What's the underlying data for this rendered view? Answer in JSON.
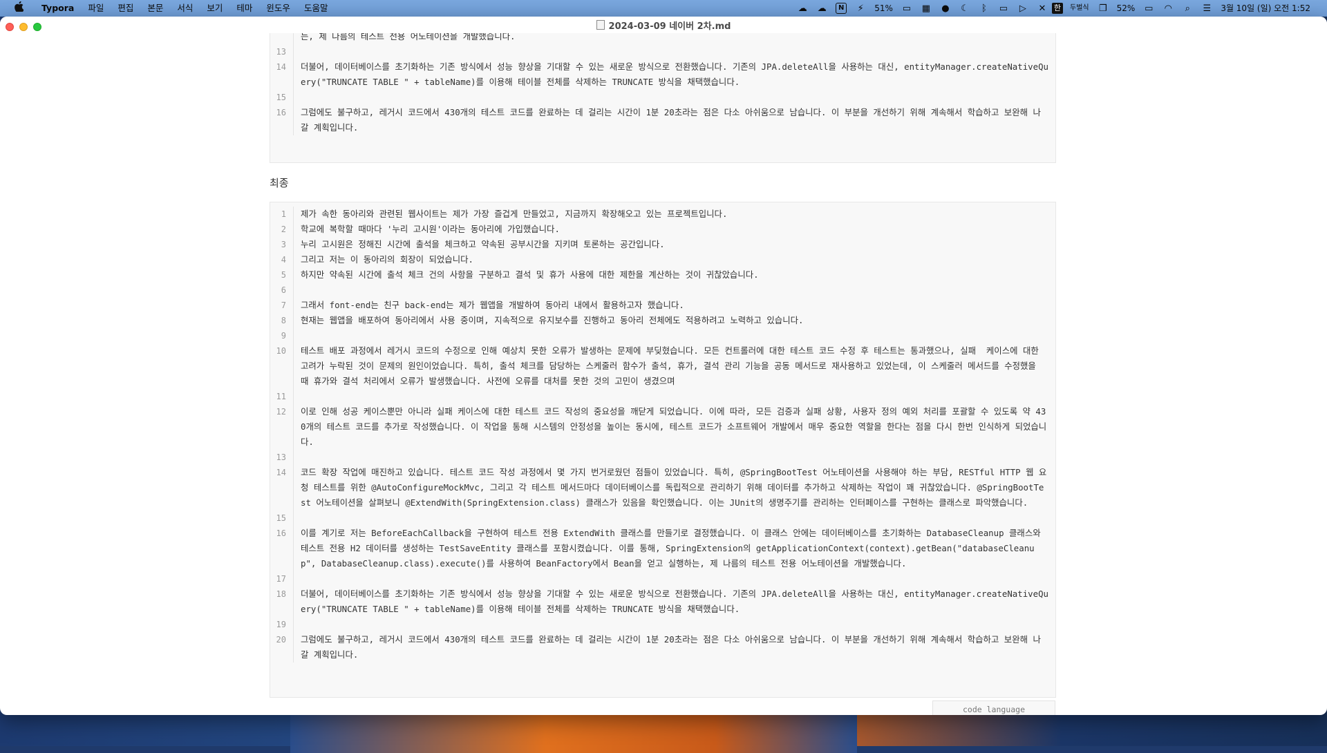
{
  "menubar": {
    "apple": "",
    "app_name": "Typora",
    "menus": [
      "파일",
      "편집",
      "본문",
      "서식",
      "보기",
      "테마",
      "윈도우",
      "도움말"
    ],
    "battery1": "51%",
    "ime_badge": "한",
    "ime_label": "두벌식",
    "battery2": "52%",
    "datetime": "3월 10일 (일) 오전 1:52"
  },
  "window": {
    "title": "2024-03-09 네이버 2차.md"
  },
  "top_block": {
    "lines": [
      {
        "n": "",
        "text": "는, 제 나름의 테스트 전용 어노테이션을 개발했습니다."
      },
      {
        "n": "13",
        "text": ""
      },
      {
        "n": "14",
        "text": "더불어, 데이터베이스를 초기화하는 기존 방식에서 성능 향상을 기대할 수 있는 새로운 방식으로 전환했습니다. 기존의 JPA.deleteAll을 사용하는 대신, entityManager.createNativeQuery(\"TRUNCATE TABLE \" + tableName)를 이용해 테이블 전체를 삭제하는 TRUNCATE 방식을 채택했습니다."
      },
      {
        "n": "15",
        "text": ""
      },
      {
        "n": "16",
        "text": "그럼에도 불구하고, 레거시 코드에서 430개의 테스트 코드를 완료하는 데 걸리는 시간이 1분 20초라는 점은 다소 아쉬움으로 남습니다. 이 부분을 개선하기 위해 계속해서 학습하고 보완해 나갈 계획입니다."
      }
    ]
  },
  "heading": "최종",
  "bottom_block": {
    "lines": [
      {
        "n": "1",
        "text": "제가 속한 동아리와 관련된 웹사이트는 제가 가장 즐겁게 만들었고, 지금까지 확장해오고 있는 프로젝트입니다."
      },
      {
        "n": "2",
        "text": "학교에 복학할 때마다 '누리 고시원'이라는 동아리에 가입했습니다."
      },
      {
        "n": "3",
        "text": "누리 고시원은 정해진 시간에 출석을 체크하고 약속된 공부시간을 지키며 토론하는 공간입니다."
      },
      {
        "n": "4",
        "text": "그리고 저는 이 동아리의 회장이 되었습니다."
      },
      {
        "n": "5",
        "text": "하지만 약속된 시간에 출석 체크 건의 사항을 구분하고 결석 및 휴가 사용에 대한 제한을 계산하는 것이 귀찮았습니다."
      },
      {
        "n": "6",
        "text": ""
      },
      {
        "n": "7",
        "text": "그래서 font-end는 친구 back-end는 제가 웹앱을 개발하여 동아리 내에서 활용하고자 했습니다."
      },
      {
        "n": "8",
        "text": "현재는 웹앱을 배포하여 동아리에서 사용 중이며, 지속적으로 유지보수를 진행하고 동아리 전체에도 적용하려고 노력하고 있습니다."
      },
      {
        "n": "9",
        "text": ""
      },
      {
        "n": "10",
        "text": "테스트 배포 과정에서 레거시 코드의 수정으로 인해 예상치 못한 오류가 발생하는 문제에 부딪혔습니다. 모든 컨트롤러에 대한 테스트 코드 수정 후 테스트는 통과했으나, 실패  케이스에 대한 고려가 누락된 것이 문제의 원인이었습니다. 특히, 출석 체크를 담당하는 스케줄러 함수가 출석, 휴가, 결석 관리 기능을 공동 메서드로 재사용하고 있었는데, 이 스케줄러 메서드를 수정했을 때 휴가와 결석 처리에서 오류가 발생했습니다. 사전에 오류를 대처를 못한 것의 고민이 생겼으며"
      },
      {
        "n": "11",
        "text": ""
      },
      {
        "n": "12",
        "text": "이로 인해 성공 케이스뿐만 아니라 실패 케이스에 대한 테스트 코드 작성의 중요성을 깨닫게 되었습니다. 이에 따라, 모든 검증과 실패 상황, 사용자 정의 예외 처리를 포괄할 수 있도록 약 430개의 테스트 코드를 추가로 작성했습니다. 이 작업을 통해 시스템의 안정성을 높이는 동시에, 테스트 코드가 소프트웨어 개발에서 매우 중요한 역할을 한다는 점을 다시 한번 인식하게 되었습니다."
      },
      {
        "n": "13",
        "text": ""
      },
      {
        "n": "14",
        "text": "코드 확장 작업에 매진하고 있습니다. 테스트 코드 작성 과정에서 몇 가지 번거로웠던 점들이 있었습니다. 특히, @SpringBootTest 어노테이션을 사용해야 하는 부담, RESTful HTTP 웹 요청 테스트를 위한 @AutoConfigureMockMvc, 그리고 각 테스트 메서드마다 데이터베이스를 독립적으로 관리하기 위해 데이터를 추가하고 삭제하는 작업이 꽤 귀찮았습니다. @SpringBootTest 어노테이션을 살펴보니 @ExtendWith(SpringExtension.class) 클래스가 있음을 확인했습니다. 이는 JUnit의 생명주기를 관리하는 인터페이스를 구현하는 클래스로 파악했습니다."
      },
      {
        "n": "15",
        "text": ""
      },
      {
        "n": "16",
        "text": "이를 계기로 저는 BeforeEachCallback을 구현하여 테스트 전용 ExtendWith 클래스를 만들기로 결정했습니다. 이 클래스 안에는 데이터베이스를 초기화하는 DatabaseCleanup 클래스와 테스트 전용 H2 데이터를 생성하는 TestSaveEntity 클래스를 포함시켰습니다. 이를 통해, SpringExtension의 getApplicationContext(context).getBean(\"databaseCleanup\", DatabaseCleanup.class).execute()를 사용하여 BeanFactory에서 Bean을 얻고 실행하는, 제 나름의 테스트 전용 어노테이션을 개발했습니다."
      },
      {
        "n": "17",
        "text": ""
      },
      {
        "n": "18",
        "text": "더불어, 데이터베이스를 초기화하는 기존 방식에서 성능 향상을 기대할 수 있는 새로운 방식으로 전환했습니다. 기존의 JPA.deleteAll을 사용하는 대신, entityManager.createNativeQuery(\"TRUNCATE TABLE \" + tableName)를 이용해 테이블 전체를 삭제하는 TRUNCATE 방식을 채택했습니다."
      },
      {
        "n": "19",
        "text": ""
      },
      {
        "n": "20",
        "text": "그럼에도 불구하고, 레거시 코드에서 430개의 테스트 코드를 완료하는 데 걸리는 시간이 1분 20초라는 점은 다소 아쉬움으로 남습니다. 이 부분을 개선하기 위해 계속해서 학습하고 보완해 나갈 계획입니다."
      }
    ]
  },
  "code_language_placeholder": "code language"
}
